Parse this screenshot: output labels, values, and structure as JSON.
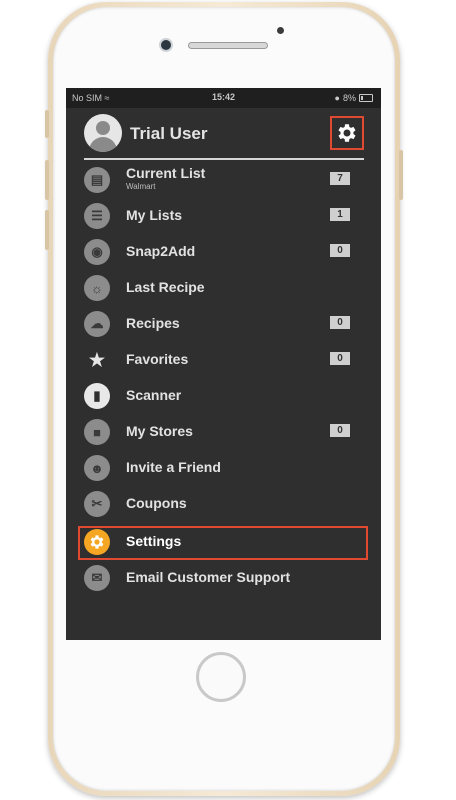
{
  "status_bar": {
    "carrier": "No SIM",
    "time": "15:42",
    "battery": "8%"
  },
  "profile": {
    "name": "Trial User",
    "settings_icon": "gear-icon"
  },
  "menu": {
    "items": [
      {
        "label": "Current List",
        "sublabel": "Walmart",
        "badge": "7",
        "icon": "list-icon"
      },
      {
        "label": "My Lists",
        "badge": "1",
        "icon": "lists-icon"
      },
      {
        "label": "Snap2Add",
        "badge": "0",
        "icon": "camera-icon"
      },
      {
        "label": "Last Recipe",
        "icon": "recipe-icon"
      },
      {
        "label": "Recipes",
        "badge": "0",
        "icon": "chef-hat-icon"
      },
      {
        "label": "Favorites",
        "badge": "0",
        "icon": "star-icon"
      },
      {
        "label": "Scanner",
        "icon": "barcode-icon"
      },
      {
        "label": "My Stores",
        "badge": "0",
        "icon": "store-icon"
      },
      {
        "label": "Invite a Friend",
        "icon": "invite-icon"
      },
      {
        "label": "Coupons",
        "icon": "coupon-icon"
      },
      {
        "label": "Settings",
        "icon": "gear-icon",
        "selected": true
      },
      {
        "label": "Email Customer Support",
        "icon": "support-icon"
      }
    ]
  },
  "colors": {
    "accent": "#f5a623",
    "highlight_border": "#e04a32",
    "background": "#2f2f2f"
  }
}
